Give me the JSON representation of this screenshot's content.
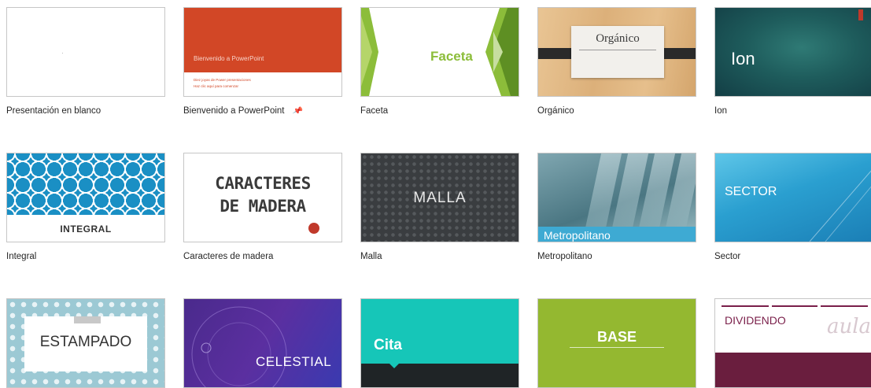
{
  "templates": [
    {
      "name": "Presentación en blanco"
    },
    {
      "name": "Bienvenido a PowerPoint",
      "thumb_title": "Bienvenido a PowerPoint",
      "thumb_sub1": "Diez joyas de Power presentaciones",
      "thumb_sub2": "Haz clic aquí para comenzar"
    },
    {
      "name": "Faceta",
      "thumb_title": "Faceta"
    },
    {
      "name": "Orgánico",
      "thumb_title": "Orgánico"
    },
    {
      "name": "Ion",
      "thumb_title": "Ion"
    },
    {
      "name": "Integral",
      "thumb_title": "INTEGRAL"
    },
    {
      "name": "Caracteres de madera",
      "thumb_line1": "CARACTERES",
      "thumb_line2": "DE MADERA"
    },
    {
      "name": "Malla",
      "thumb_title": "MALLA"
    },
    {
      "name": "Metropolitano",
      "thumb_title": "Metropolitano"
    },
    {
      "name": "Sector",
      "thumb_title": "SECTOR"
    },
    {
      "name": "",
      "thumb_title": "ESTAMPADO"
    },
    {
      "name": "",
      "thumb_title": "CELESTIAL"
    },
    {
      "name": "",
      "thumb_title": "Cita"
    },
    {
      "name": "",
      "thumb_title": "BASE"
    },
    {
      "name": "",
      "thumb_title": "DIVIDENDO",
      "thumb_script": "aula"
    }
  ],
  "pin_icon": "pin-icon",
  "colors": {
    "bienvenido_red": "#d24726",
    "faceta_green": "#8cbd3a",
    "ion_teal": "#1e5c5c",
    "integral_blue": "#1a8fc4",
    "metro_blue": "#3eaad3",
    "cita_teal": "#16c6b8",
    "base_green": "#94b830",
    "dividendo_wine": "#6a1e3e"
  }
}
